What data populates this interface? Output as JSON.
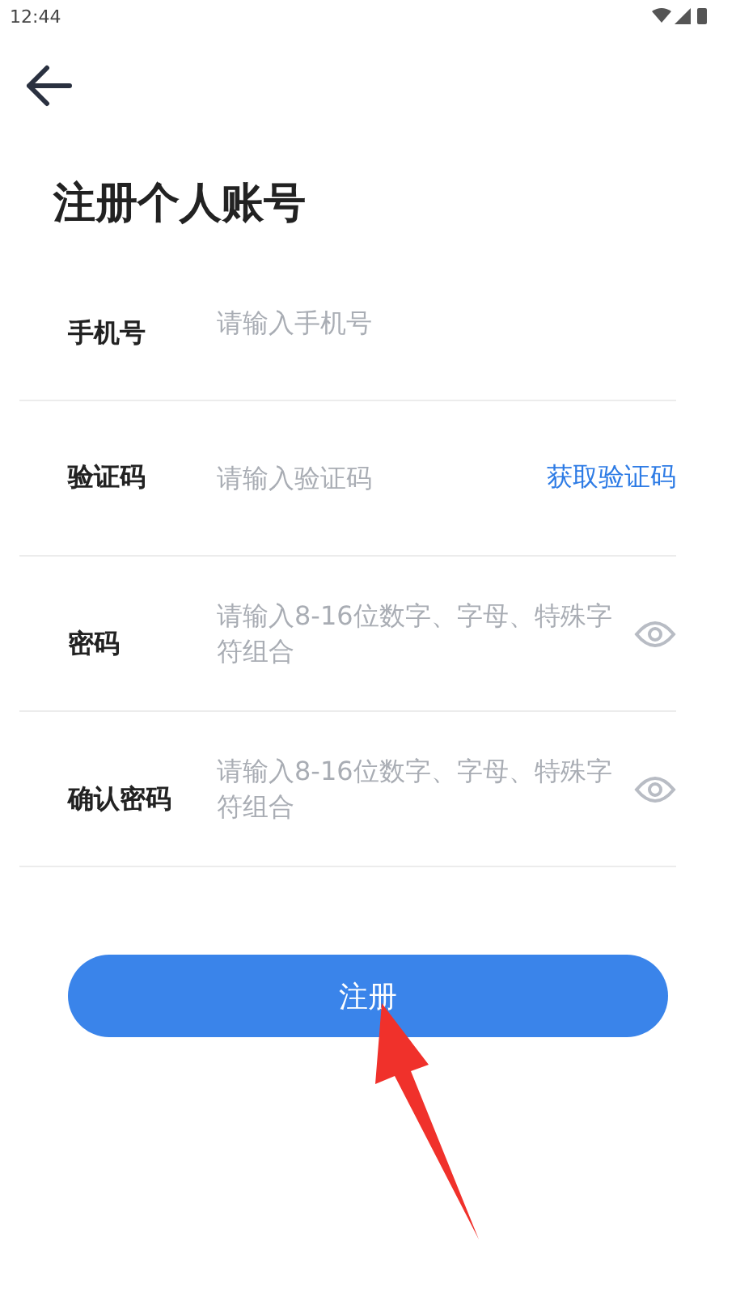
{
  "status_bar": {
    "time": "12:44"
  },
  "title": "注册个人账号",
  "fields": [
    {
      "kind": "text",
      "label": "手机号",
      "placeholder": "请输入手机号"
    },
    {
      "kind": "code",
      "label": "验证码",
      "placeholder": "请输入验证码",
      "action": "获取验证码"
    },
    {
      "kind": "password",
      "label": "密码",
      "placeholder": "请输入8-16位数字、字母、特殊字符组合"
    },
    {
      "kind": "password",
      "label": "确认密码",
      "placeholder": "请输入8-16位数字、字母、特殊字符组合"
    }
  ],
  "submit": "注册"
}
